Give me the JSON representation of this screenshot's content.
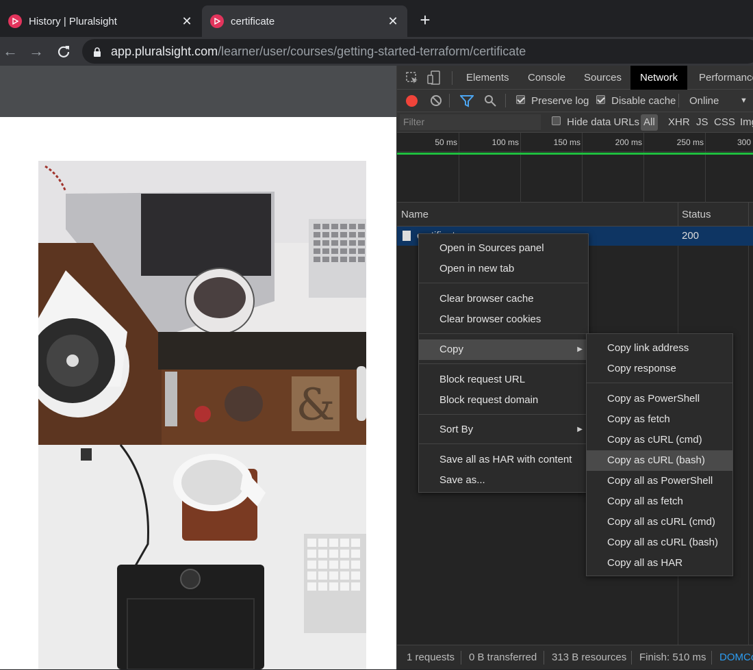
{
  "tabs": [
    {
      "title": "History | Pluralsight"
    },
    {
      "title": "certificate"
    }
  ],
  "toolbar": {
    "url_host": "app.pluralsight.com",
    "url_path": "/learner/user/courses/getting-started-terraform/certificate"
  },
  "devtools": {
    "tabs": [
      "Elements",
      "Console",
      "Sources",
      "Network",
      "Performance"
    ],
    "selected_tab": "Network",
    "controls": {
      "preserve_log": "Preserve log",
      "disable_cache": "Disable cache",
      "throttle": "Online"
    },
    "filter": {
      "placeholder": "Filter",
      "hide_data_urls": "Hide data URLs",
      "types": [
        "All",
        "XHR",
        "JS",
        "CSS",
        "Img"
      ]
    },
    "timeline_ticks": [
      "50 ms",
      "100 ms",
      "150 ms",
      "200 ms",
      "250 ms",
      "300"
    ],
    "table": {
      "columns": [
        "Name",
        "Status"
      ],
      "rows": [
        {
          "name": "certificate",
          "status": "200"
        }
      ]
    },
    "status_bar": {
      "requests": "1 requests",
      "transferred": "0 B transferred",
      "resources": "313 B resources",
      "finish": "Finish: 510 ms",
      "dom": "DOMCo"
    }
  },
  "context_menu": {
    "items": [
      "Open in Sources panel",
      "Open in new tab",
      "Clear browser cache",
      "Clear browser cookies",
      "Copy",
      "Block request URL",
      "Block request domain",
      "Sort By",
      "Save all as HAR with content",
      "Save as..."
    ]
  },
  "copy_submenu": {
    "items": [
      "Copy link address",
      "Copy response",
      "Copy as PowerShell",
      "Copy as fetch",
      "Copy as cURL (cmd)",
      "Copy as cURL (bash)",
      "Copy all as PowerShell",
      "Copy all as fetch",
      "Copy all as cURL (cmd)",
      "Copy all as cURL (bash)",
      "Copy all as HAR"
    ],
    "highlighted": "Copy as cURL (bash)"
  },
  "colors": {
    "favicon": "#e2345c",
    "record": "#f0443a",
    "selected_row": "#0e3563",
    "timeline_bar": "#1fbf3f",
    "link": "#2c9cf0"
  }
}
